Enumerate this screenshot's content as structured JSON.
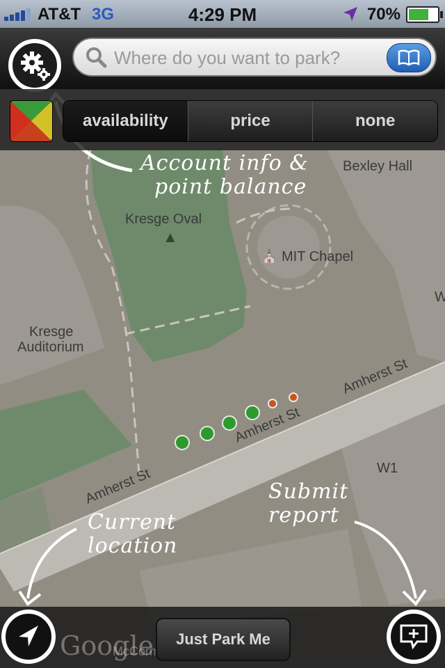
{
  "status_bar": {
    "carrier": "AT&T",
    "network": "3G",
    "time": "4:29 PM",
    "battery": "70%",
    "battery_level": 0.7,
    "signal_bars": 4
  },
  "top_bar": {
    "search_placeholder": "Where do you want to park?",
    "settings_icon": "gear-icon",
    "bookmarks_icon": "book-icon"
  },
  "filter_bar": {
    "legend_icon": "color-legend-icon",
    "segments": [
      "availability",
      "price",
      "none"
    ],
    "selected": "availability"
  },
  "map": {
    "labels": {
      "bexley": "Bexley Hall",
      "kresge_oval": "Kresge Oval",
      "mit_chapel": "MIT Chapel",
      "kresge_aud_1": "Kresge",
      "kresge_aud_2": "Auditorium",
      "amherst_1": "Amherst St",
      "amherst_2": "Amherst St",
      "amherst_3": "Amherst St",
      "w1": "W1",
      "w_edge_1": "W",
      "w_edge_2": "W",
      "google": "Google",
      "mccormick": "McCorm"
    },
    "parking_spots": [
      {
        "status": "available",
        "color": "#2e9a2e"
      },
      {
        "status": "available",
        "color": "#2e9a2e"
      },
      {
        "status": "available",
        "color": "#2e9a2e"
      },
      {
        "status": "available",
        "color": "#2e9a2e"
      },
      {
        "status": "occupied",
        "color": "#c9541d"
      },
      {
        "status": "occupied",
        "color": "#c9541d"
      }
    ]
  },
  "annotations": {
    "account_line1": "Account info &",
    "account_line2": "point balance",
    "current_line1": "Current",
    "current_line2": "location",
    "submit_line1": "Submit",
    "submit_line2": "report"
  },
  "bottom_bar": {
    "just_park_label": "Just Park Me",
    "location_icon": "location-arrow-icon",
    "report_icon": "add-report-icon"
  },
  "colors": {
    "accent_blue": "#2b66c4",
    "available": "#2e9a2e",
    "occupied": "#c9541d"
  }
}
